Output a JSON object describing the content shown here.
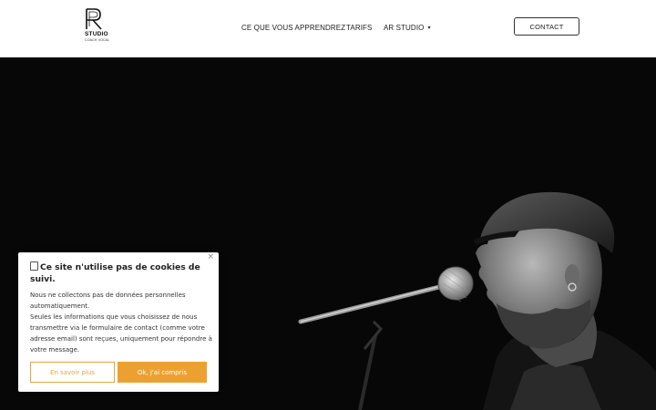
{
  "logo": {
    "mark": "R",
    "name": "STUDIO",
    "tagline": "COACH VOCAL"
  },
  "nav": {
    "items": [
      {
        "label": "CE QUE VOUS APPRENDREZ"
      },
      {
        "label": "TARIFS"
      },
      {
        "label": "AR STUDIO",
        "has_dropdown": true
      }
    ],
    "dropdown_caret": "▾",
    "contact_label": "CONTACT"
  },
  "hero": {
    "image": "black-and-white photo of bearded singer in cap singing into microphone on stand"
  },
  "cookie_banner": {
    "icon": "cookie-icon",
    "title": "Ce site n'utilise pas de cookies de suivi.",
    "paragraph_1": "Nous ne collectons pas de données personnelles automatiquement.",
    "paragraph_2": "Seules les informations que vous choisissez de nous transmettre via le formulaire de contact (comme votre adresse email) sont reçues, uniquement pour répondre à votre message.",
    "close_symbol": "×",
    "learn_more_label": "En savoir plus",
    "accept_label": "Ok, j'ai compris"
  },
  "colors": {
    "accent": "#eba132",
    "header_bg": "#ffffff",
    "hero_bg": "#070707"
  }
}
